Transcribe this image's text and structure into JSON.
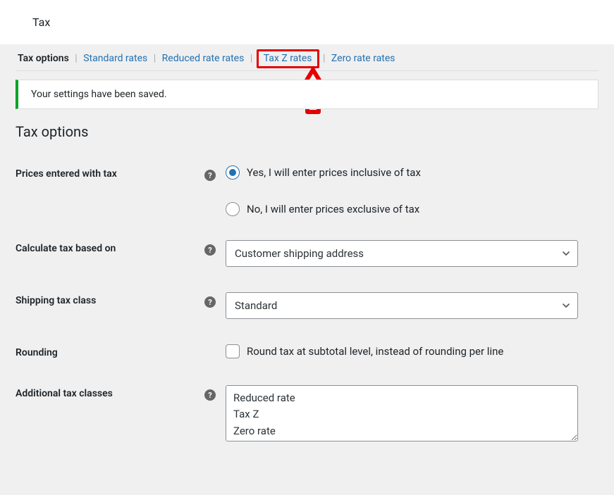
{
  "header": {
    "title": "Tax"
  },
  "tabs": {
    "items": [
      {
        "label": "Tax options",
        "active": true
      },
      {
        "label": "Standard rates"
      },
      {
        "label": "Reduced rate rates"
      },
      {
        "label": "Tax Z rates",
        "highlight": true
      },
      {
        "label": "Zero rate rates"
      }
    ]
  },
  "notice": {
    "text": "Your settings have been saved."
  },
  "section": {
    "title": "Tax options"
  },
  "form": {
    "prices_label": "Prices entered with tax",
    "prices_opt1": "Yes, I will enter prices inclusive of tax",
    "prices_opt2": "No, I will enter prices exclusive of tax",
    "calc_label": "Calculate tax based on",
    "calc_value": "Customer shipping address",
    "shipclass_label": "Shipping tax class",
    "shipclass_value": "Standard",
    "rounding_label": "Rounding",
    "rounding_check": "Round tax at subtotal level, instead of rounding per line",
    "additional_label": "Additional tax classes",
    "additional_value": "Reduced rate\nTax Z\nZero rate"
  },
  "help_glyph": "?"
}
